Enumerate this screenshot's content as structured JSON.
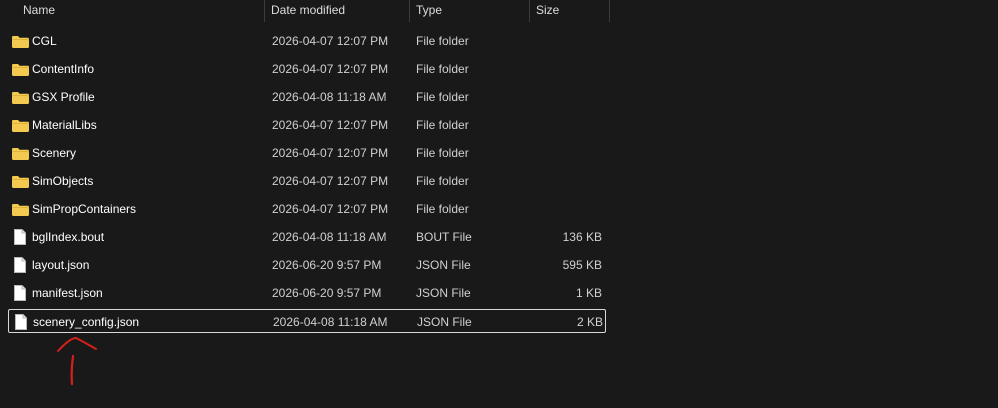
{
  "columns": {
    "name": "Name",
    "date_modified": "Date modified",
    "type": "Type",
    "size": "Size"
  },
  "files": [
    {
      "name": "CGL",
      "date": "2026-04-07 12:07 PM",
      "type": "File folder",
      "size": "",
      "icon": "folder-icon"
    },
    {
      "name": "ContentInfo",
      "date": "2026-04-07 12:07 PM",
      "type": "File folder",
      "size": "",
      "icon": "folder-icon"
    },
    {
      "name": "GSX Profile",
      "date": "2026-04-08 11:18 AM",
      "type": "File folder",
      "size": "",
      "icon": "folder-icon"
    },
    {
      "name": "MaterialLibs",
      "date": "2026-04-07 12:07 PM",
      "type": "File folder",
      "size": "",
      "icon": "folder-icon"
    },
    {
      "name": "Scenery",
      "date": "2026-04-07 12:07 PM",
      "type": "File folder",
      "size": "",
      "icon": "folder-icon"
    },
    {
      "name": "SimObjects",
      "date": "2026-04-07 12:07 PM",
      "type": "File folder",
      "size": "",
      "icon": "folder-icon"
    },
    {
      "name": "SimPropContainers",
      "date": "2026-04-07 12:07 PM",
      "type": "File folder",
      "size": "",
      "icon": "folder-icon"
    },
    {
      "name": "bglIndex.bout",
      "date": "2026-04-08 11:18 AM",
      "type": "BOUT File",
      "size": "136 KB",
      "icon": "file-icon"
    },
    {
      "name": "layout.json",
      "date": "2026-06-20 9:57 PM",
      "type": "JSON File",
      "size": "595 KB",
      "icon": "file-icon"
    },
    {
      "name": "manifest.json",
      "date": "2026-06-20 9:57 PM",
      "type": "JSON File",
      "size": "1 KB",
      "icon": "file-icon"
    },
    {
      "name": "scenery_config.json",
      "date": "2026-04-08 11:18 AM",
      "type": "JSON File",
      "size": "2 KB",
      "icon": "file-icon",
      "selected": true
    }
  ],
  "colors": {
    "background": "#191919",
    "folder": "#f3c94f",
    "annotation": "#d6201c"
  }
}
